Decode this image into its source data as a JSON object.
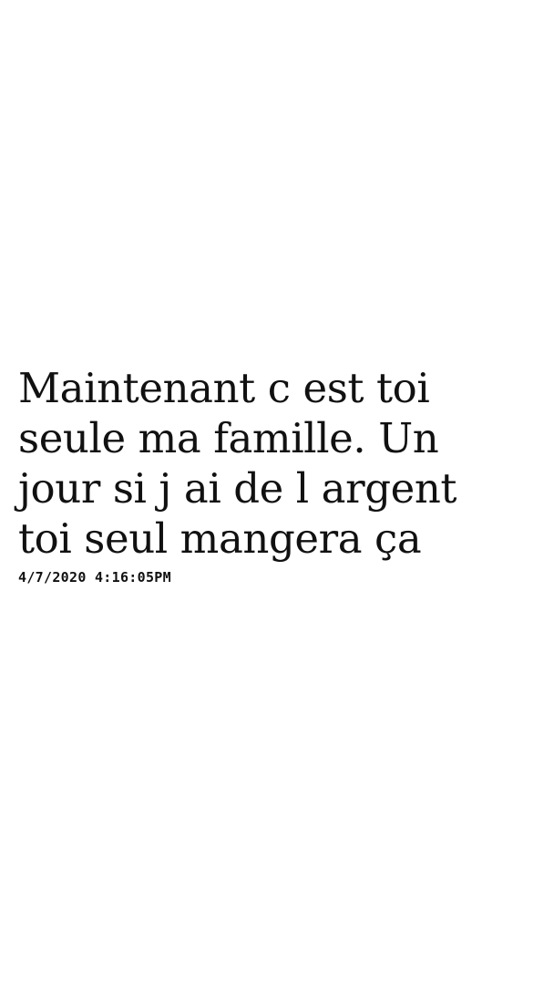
{
  "post": {
    "message_lines": [
      "Maintenant c est toi",
      "seule ma famille. Un",
      "jour si j ai de l argent",
      "toi seul mangera ça"
    ],
    "timestamp": "4/7/2020 4:16:05PM"
  }
}
